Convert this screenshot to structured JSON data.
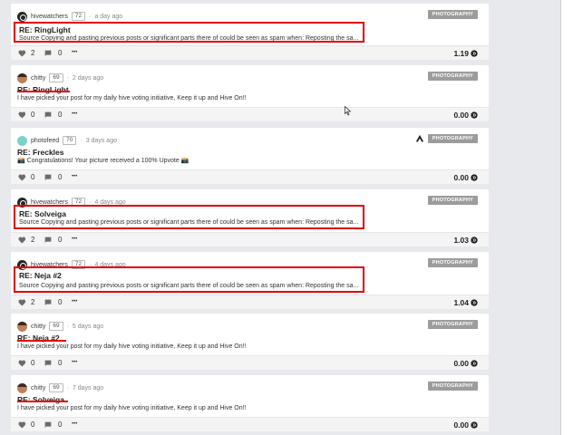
{
  "colors": {
    "tag_bg": "#9c9c9c",
    "highlight": "#e00000",
    "footer_bg": "#f4f4f4"
  },
  "icons": {
    "vote": "heart-icon",
    "comment": "comment-icon",
    "more": "ellipsis-icon",
    "payout": "hive-payout-icon",
    "community": "hive-logo-icon"
  },
  "cards": [
    {
      "author": "hivewatchers",
      "rep": "72",
      "sep": "·",
      "time": "a day ago",
      "tag": "PHOTOGRAPHY",
      "title": "RE: RingLight",
      "body": "Source Copying and pasting previous posts or significant parts there of could be seen as spam when: Reposting the sa...",
      "votes": "2",
      "comments": "0",
      "more": "•••",
      "payout": "1.19"
    },
    {
      "author": "chitty",
      "rep": "69",
      "sep": "·",
      "time": "2 days ago",
      "tag": "PHOTOGRAPHY",
      "title": "RE: RingLight",
      "body": "I have picked your post for my daily hive voting initiative, Keep it up and Hive On!!",
      "votes": "0",
      "comments": "0",
      "more": "•••",
      "payout": "0.00"
    },
    {
      "author": "photofeed",
      "rep": "70",
      "sep": "·",
      "time": "3 days ago",
      "tag": "PHOTOGRAPHY",
      "title": "RE: Freckles",
      "body": "📸 Congratulations! Your picture received a 100% Upvote 📸",
      "votes": "0",
      "comments": "0",
      "more": "•••",
      "payout": "0.00"
    },
    {
      "author": "hivewatchers",
      "rep": "72",
      "sep": "·",
      "time": "4 days ago",
      "tag": "PHOTOGRAPHY",
      "title": "RE: Solveiga",
      "body": "Source Copying and pasting previous posts or significant parts there of could be seen as spam when: Reposting the sa...",
      "votes": "2",
      "comments": "0",
      "more": "•••",
      "payout": "1.03"
    },
    {
      "author": "hivewatchers",
      "rep": "72",
      "sep": "·",
      "time": "4 days ago",
      "tag": "PHOTOGRAPHY",
      "title": "RE: Neja #2",
      "body": "Source Copying and pasting previous posts or significant parts there of could be seen as spam when: Reposting the sa...",
      "votes": "2",
      "comments": "0",
      "more": "•••",
      "payout": "1.04"
    },
    {
      "author": "chitty",
      "rep": "69",
      "sep": "·",
      "time": "5 days ago",
      "tag": "PHOTOGRAPHY",
      "title": "RE: Neja #2",
      "body": "I have picked your post for my daily hive voting initiative, Keep it up and Hive On!!",
      "votes": "0",
      "comments": "0",
      "more": "•••",
      "payout": "0.00"
    },
    {
      "author": "chitty",
      "rep": "69",
      "sep": "·",
      "time": "7 days ago",
      "tag": "PHOTOGRAPHY",
      "title": "RE: Solveiga",
      "body": "I have picked your post for my daily hive voting initiative, Keep it up and Hive On!!",
      "votes": "0",
      "comments": "0",
      "more": "•••",
      "payout": "0.00"
    }
  ]
}
